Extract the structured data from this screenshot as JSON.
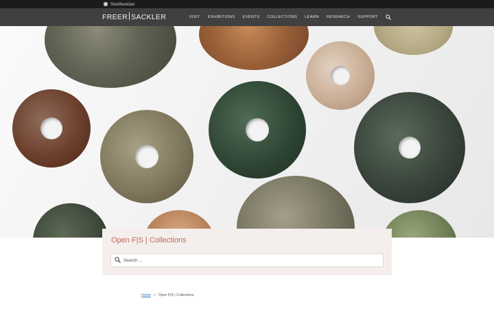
{
  "topbar": {
    "brand": "Smithsonian"
  },
  "header": {
    "logo_left": "FREER",
    "logo_right": "SACKLER",
    "nav": [
      "VISIT",
      "EXHIBITIONS",
      "EVENTS",
      "COLLECTIONS",
      "LEARN",
      "RESEARCH",
      "SUPPORT"
    ],
    "search_icon": "search-icon"
  },
  "panel": {
    "title": "Open F|S | Collections",
    "search_placeholder": "Search ..."
  },
  "breadcrumb": {
    "home": "Home",
    "separator": "»",
    "current": "Open F|S | Collections"
  },
  "colors": {
    "topbar": "#1b1b1b",
    "navbar": "#404040",
    "accent_title": "#c4665a",
    "panel_bg": "#f4efec",
    "link": "#3a74b8"
  }
}
